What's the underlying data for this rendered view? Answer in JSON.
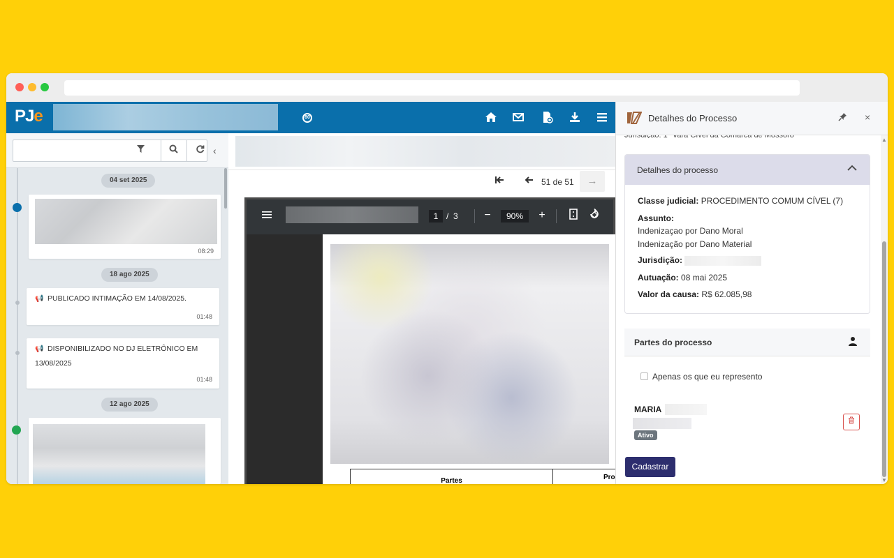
{
  "app": {
    "logo_main": "PJ",
    "logo_accent": "e"
  },
  "header": {
    "icons": [
      "home-icon",
      "mail-icon",
      "document-add-icon",
      "download-icon",
      "menu-icon"
    ]
  },
  "timeline": {
    "groups": [
      {
        "date": "04 set 2025",
        "time": "08:29"
      },
      {
        "date": "18 ago 2025",
        "items": [
          {
            "text": "PUBLICADO INTIMAÇÃO EM 14/08/2025.",
            "time": "01:48"
          },
          {
            "text_line1": "DISPONIBILIZADO NO DJ ELETRÔNICO EM",
            "text_line2": "13/08/2025",
            "time": "01:48"
          }
        ]
      },
      {
        "date": "12 ago 2025"
      }
    ]
  },
  "navigator": {
    "count": "51 de 51"
  },
  "pdf": {
    "page": "1",
    "separator": "/",
    "total": "3",
    "zoom": "90%",
    "table_col1": "Partes",
    "table_col2": "Pro"
  },
  "panel": {
    "title": "Detalhes do Processo",
    "cutoff_text": "Jurisdição: 1ª Vara Cível da Comarca de Mossoró",
    "accordion_title": "Detalhes do processo",
    "classe_label": "Classe judicial:",
    "classe_value": "PROCEDIMENTO COMUM CÍVEL (7)",
    "assunto_label": "Assunto:",
    "assunto_1": "Indenizaçao por Dano Moral",
    "assunto_2": "Indenização por Dano Material",
    "jurisdicao_label": "Jurisdição:",
    "autuacao_label": "Autuação:",
    "autuacao_value": "08 mai 2025",
    "valor_label": "Valor da causa:",
    "valor_value": "R$ 62.085,98",
    "partes_title": "Partes do processo",
    "checkbox_label": "Apenas os que eu represento",
    "party_name": "MARIA",
    "party_status": "Ativo",
    "submit_label": "Cadastrar"
  },
  "colors": {
    "brand_blue": "#0A6FAB",
    "logo_accent": "#F7941D",
    "panel_accent": "#2D2E6E",
    "background": "#FFD008"
  }
}
